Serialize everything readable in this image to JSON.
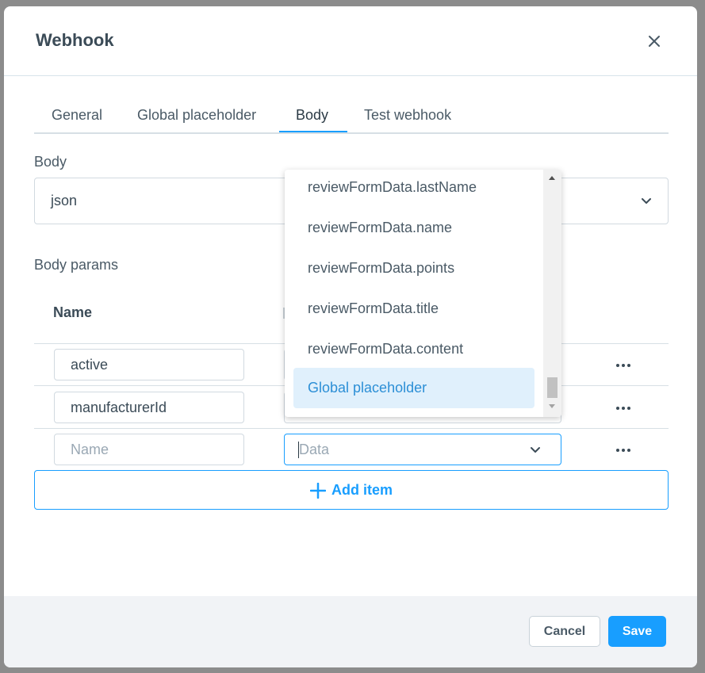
{
  "modal": {
    "title": "Webhook"
  },
  "tabs": [
    {
      "label": "General"
    },
    {
      "label": "Global placeholder"
    },
    {
      "label": "Body"
    },
    {
      "label": "Test webhook"
    }
  ],
  "active_tab": "Body",
  "body_section": {
    "label": "Body",
    "selected": "json"
  },
  "body_params": {
    "label": "Body params",
    "columns": [
      "Name"
    ],
    "rows": [
      {
        "name": "active"
      },
      {
        "name": "manufacturerId"
      },
      {
        "name": ""
      }
    ],
    "name_placeholder": "Name",
    "data_placeholder": "Data",
    "add_item_label": "Add item"
  },
  "dropdown": {
    "options": [
      "reviewFormData.lastName",
      "reviewFormData.name",
      "reviewFormData.points",
      "reviewFormData.title",
      "reviewFormData.content",
      "Global placeholder"
    ],
    "highlighted": "Global placeholder"
  },
  "footer": {
    "cancel_label": "Cancel",
    "save_label": "Save"
  },
  "colors": {
    "accent": "#189eff",
    "highlight_bg": "#e0f0fc",
    "text": "#3b4b57"
  },
  "icons": {
    "close": "close-icon",
    "chevron": "chevron-down-icon",
    "row_actions": "more-horizontal-icon",
    "add": "plus-icon"
  }
}
